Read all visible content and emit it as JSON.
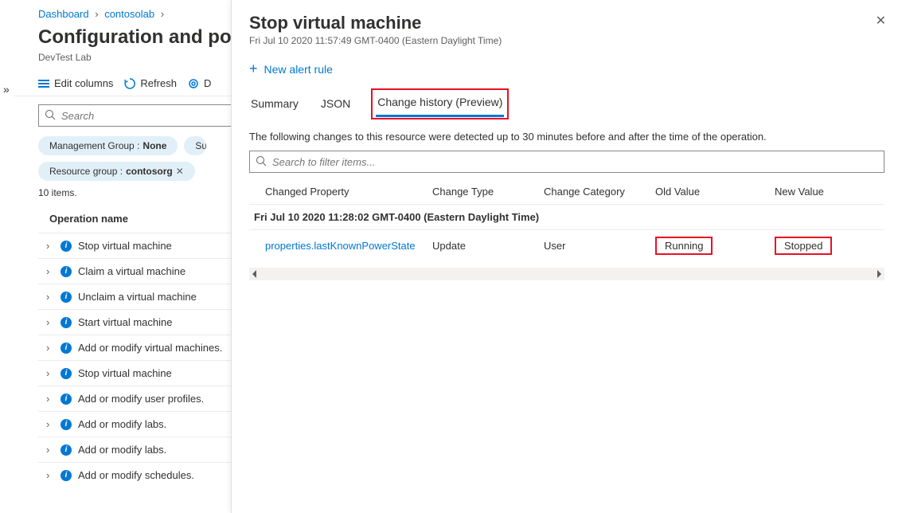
{
  "breadcrumb": {
    "dashboard": "Dashboard",
    "lab": "contosolab"
  },
  "page": {
    "title": "Configuration and policies",
    "subtitle": "DevTest Lab"
  },
  "toolbar": {
    "edit_columns": "Edit columns",
    "refresh": "Refresh",
    "third": "D"
  },
  "search": {
    "placeholder": "Search"
  },
  "filters": {
    "mg_label": "Management Group : ",
    "mg_value": "None",
    "sub_label": "Su",
    "rg_label": "Resource group : ",
    "rg_value": "contosorg"
  },
  "items_count": "10 items.",
  "ops_header": "Operation name",
  "ops": [
    "Stop virtual machine",
    "Claim a virtual machine",
    "Unclaim a virtual machine",
    "Start virtual machine",
    "Add or modify virtual machines.",
    "Stop virtual machine",
    "Add or modify user profiles.",
    "Add or modify labs.",
    "Add or modify labs.",
    "Add or modify schedules."
  ],
  "panel": {
    "title": "Stop virtual machine",
    "timestamp": "Fri Jul 10 2020 11:57:49 GMT-0400 (Eastern Daylight Time)",
    "new_alert": "New alert rule",
    "tabs": {
      "summary": "Summary",
      "json": "JSON",
      "history": "Change history (Preview)"
    },
    "desc": "The following changes to this resource were detected up to 30 minutes before and after the time of the operation.",
    "filter_placeholder": "Search to filter items...",
    "headers": {
      "prop": "Changed Property",
      "type": "Change Type",
      "cat": "Change Category",
      "old": "Old Value",
      "new": "New Value"
    },
    "group_time": "Fri Jul 10 2020 11:28:02 GMT-0400 (Eastern Daylight Time)",
    "row": {
      "prop": "properties.lastKnownPowerState",
      "type": "Update",
      "cat": "User",
      "old": "Running",
      "new": "Stopped"
    }
  }
}
